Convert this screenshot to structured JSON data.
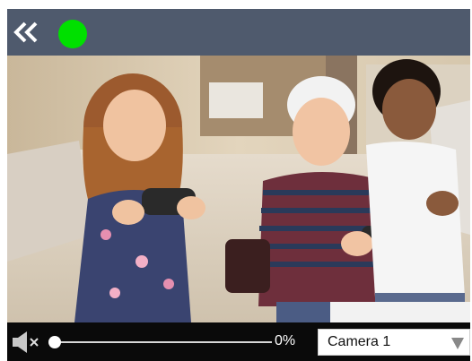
{
  "top_bar": {
    "collapse_icon": "double-chevron-left-icon",
    "status_color": "#00e000"
  },
  "video": {
    "description_icon": "camera-feed"
  },
  "bottom_bar": {
    "mute_icon": "speaker-muted-icon",
    "volume_fraction": 0.0,
    "volume_text": "0%",
    "camera_select": {
      "selected": "Camera 1"
    }
  }
}
